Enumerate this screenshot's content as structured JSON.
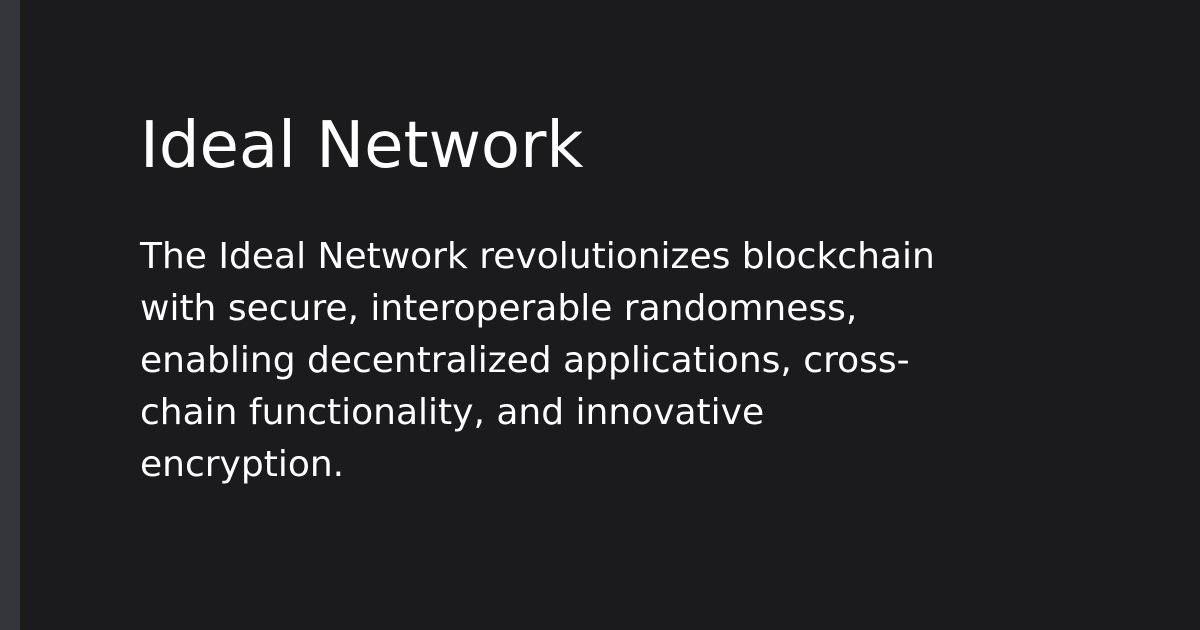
{
  "card": {
    "title": "Ideal Network",
    "description": "The Ideal Network revolutionizes blockchain with secure, interoperable randomness, enabling decentralized applications, cross-chain functionality, and innovative encryption."
  },
  "colors": {
    "background": "#1b1b1d",
    "accent_bar": "#35363b",
    "text": "#ffffff"
  }
}
